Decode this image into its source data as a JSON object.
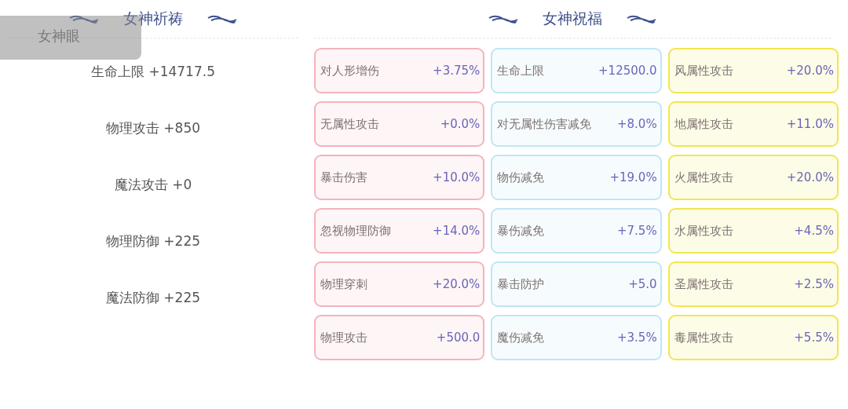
{
  "prayer": {
    "title": "女神祈祷",
    "stats": [
      "生命上限 +14717.5",
      "物理攻击 +850",
      "魔法攻击 +0",
      "物理防御 +225",
      "魔法防御 +225"
    ]
  },
  "blessing": {
    "title": "女神祝福",
    "columns": [
      {
        "color": "#f4b3bd",
        "cards": [
          {
            "label": "对人形增伤",
            "value": "+3.75%"
          },
          {
            "label": "无属性攻击",
            "value": "+0.0%"
          },
          {
            "label": "暴击伤害",
            "value": "+10.0%"
          },
          {
            "label": "忽视物理防御",
            "value": "+14.0%"
          },
          {
            "label": "物理穿刺",
            "value": "+20.0%"
          },
          {
            "label": "物理攻击",
            "value": "+500.0"
          }
        ]
      },
      {
        "color": "#bfe6f5",
        "cards": [
          {
            "label": "生命上限",
            "value": "+12500.0"
          },
          {
            "label": "对无属性伤害减免",
            "value": "+8.0%"
          },
          {
            "label": "物伤减免",
            "value": "+19.0%"
          },
          {
            "label": "暴伤减免",
            "value": "+7.5%"
          },
          {
            "label": "暴击防护",
            "value": "+5.0"
          },
          {
            "label": "魔伤减免",
            "value": "+3.5%"
          }
        ]
      },
      {
        "color": "#f2e64e",
        "cards": [
          {
            "label": "风属性攻击",
            "value": "+20.0%"
          },
          {
            "label": "地属性攻击",
            "value": "+11.0%"
          },
          {
            "label": "火属性攻击",
            "value": "+20.0%"
          },
          {
            "label": "水属性攻击",
            "value": "+4.5%"
          },
          {
            "label": "圣属性攻击",
            "value": "+2.5%"
          },
          {
            "label": "毒属性攻击",
            "value": "+5.5%"
          }
        ]
      }
    ]
  },
  "toast": {
    "text": "女神眼"
  }
}
